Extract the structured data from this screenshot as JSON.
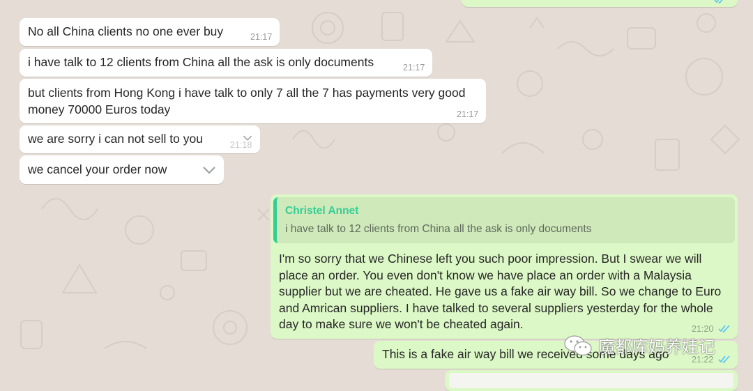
{
  "colors": {
    "wallpaper": "#e5ddd5",
    "incoming_bubble": "#ffffff",
    "outgoing_bubble": "#dcf8c6",
    "quote_bar": "#35cd96",
    "read_ticks": "#4fc3f7"
  },
  "messages": [
    {
      "text": "No all China clients no one ever buy",
      "time": "21:17"
    },
    {
      "text": "i have talk to 12 clients from China all the ask is only documents",
      "time": "21:17"
    },
    {
      "text": "but clients from Hong Kong i have talk to only 7 all the 7 has payments very good money 70000 Euros today",
      "time": "21:17"
    },
    {
      "text": "we are sorry i can not sell to you",
      "time": "21:18"
    },
    {
      "text": "we cancel your order now"
    }
  ],
  "reply": {
    "quote_author": "Christel Annet",
    "quote_text": "i have talk to 12 clients from China all the ask is only documents",
    "text": "I'm so sorry that we Chinese left you such poor impression. But I swear we will place an order. You even don't know we have place an order with a Malaysia supplier but we are cheated. He gave us a fake air way bill. So we change to Euro and Amrican suppliers. I have talked to several suppliers yesterday for the whole day to make sure we won't be cheated again.",
    "time": "21:20"
  },
  "last_message": {
    "text": "This is a fake air way bill we received some days ago",
    "time": "21:22"
  },
  "watermark": {
    "text": "魔都库妈养娃记",
    "icon": "wechat-icon"
  },
  "icons": {
    "dropdown": "chevron-down-icon",
    "read_receipt": "double-check-icon"
  }
}
